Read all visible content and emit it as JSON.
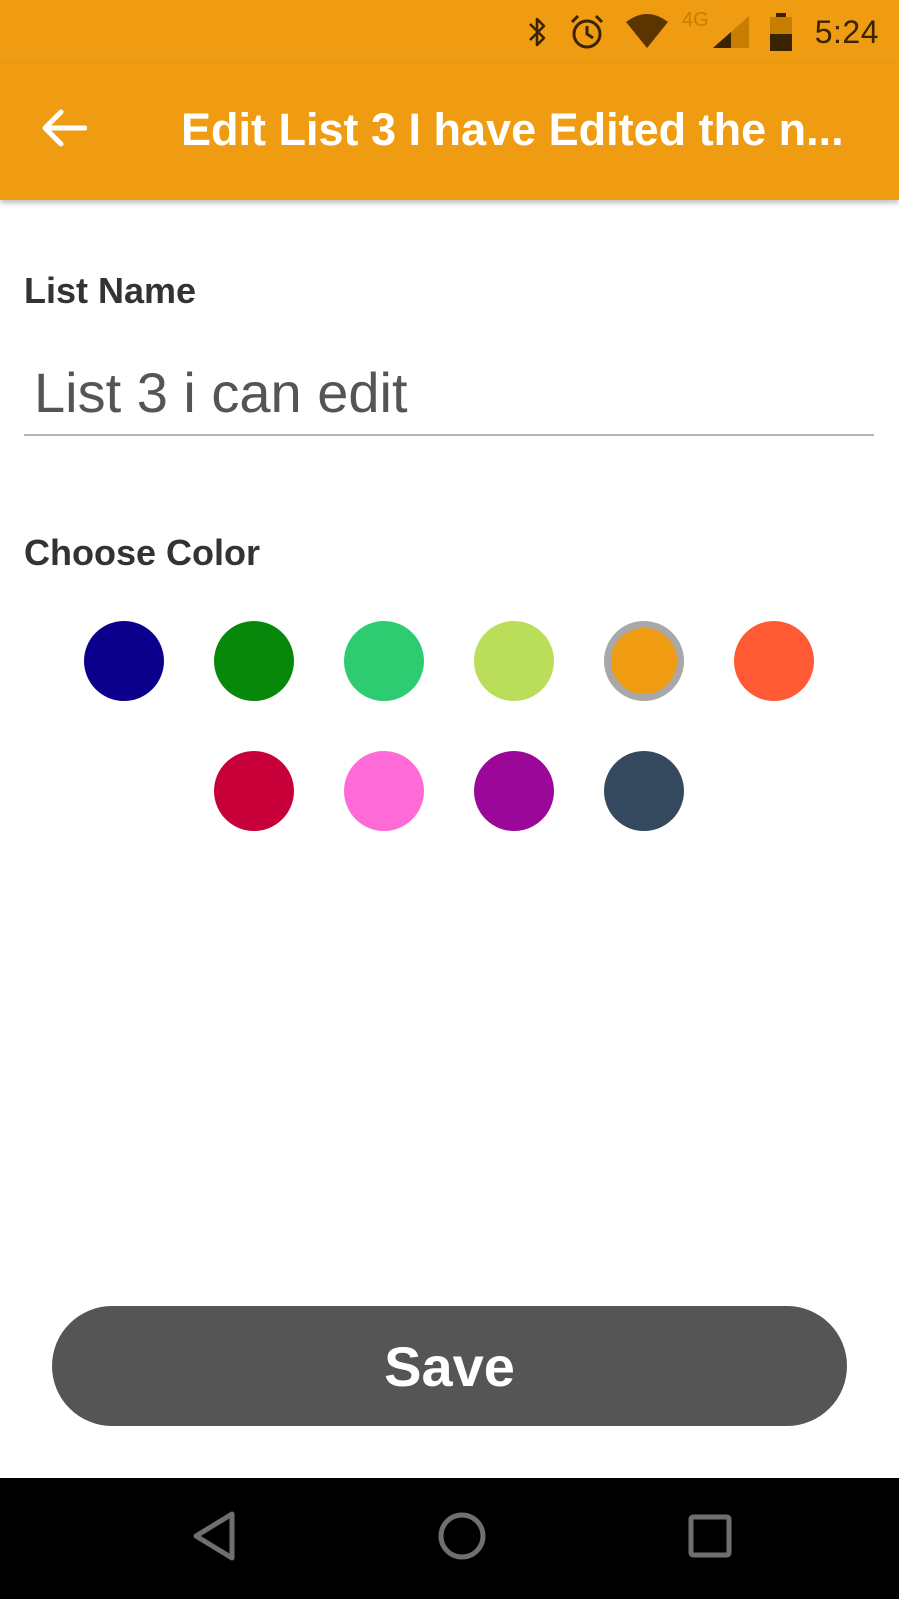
{
  "status_bar": {
    "time": "5:24",
    "network_label": "4G",
    "icons": [
      "bluetooth-icon",
      "alarm-icon",
      "wifi-icon",
      "signal-icon",
      "battery-icon"
    ]
  },
  "app_bar": {
    "title": "Edit List 3 I have Edited the n...",
    "back_icon": "arrow-left-icon",
    "background": "#EF9C12"
  },
  "form": {
    "list_name_label": "List Name",
    "list_name_value": "List 3 i can edit",
    "choose_color_label": "Choose Color"
  },
  "colors": [
    {
      "name": "navy",
      "hex": "#0A008C",
      "selected": false
    },
    {
      "name": "green",
      "hex": "#08880A",
      "selected": false
    },
    {
      "name": "emerald",
      "hex": "#2ECC71",
      "selected": false
    },
    {
      "name": "lime",
      "hex": "#BADE5A",
      "selected": false
    },
    {
      "name": "orange",
      "hex": "#EF9C12",
      "selected": true
    },
    {
      "name": "red-orange",
      "hex": "#FF5A33",
      "selected": false
    },
    {
      "name": "crimson",
      "hex": "#C70039",
      "selected": false
    },
    {
      "name": "pink",
      "hex": "#FF6BD6",
      "selected": false
    },
    {
      "name": "purple",
      "hex": "#9B0899",
      "selected": false
    },
    {
      "name": "slate",
      "hex": "#34495E",
      "selected": false
    }
  ],
  "actions": {
    "save_label": "Save"
  },
  "nav_bar": {
    "buttons": [
      "back-triangle-icon",
      "home-circle-icon",
      "recents-square-icon"
    ]
  }
}
